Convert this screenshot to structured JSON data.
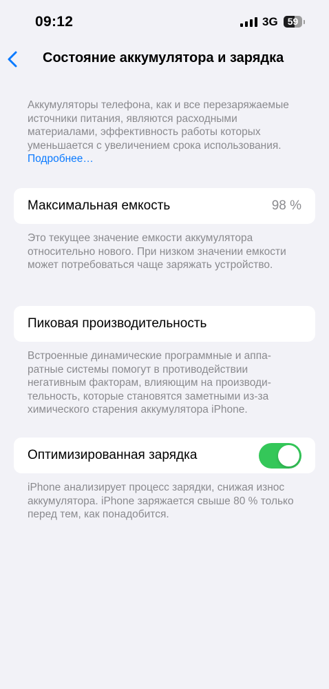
{
  "status_bar": {
    "time": "09:12",
    "network": "3G",
    "battery_level": "59",
    "battery_fraction": 0.59,
    "icons": [
      "signal-icon",
      "battery-icon"
    ]
  },
  "nav": {
    "back_icon": "chevron-left-icon",
    "title": "Состояние аккумулятора и зарядка"
  },
  "intro": {
    "text": "Аккумуляторы телефона, как и все перезаряжае­мые источники питания, являются расходными материалами, эффективность работы которых уменьшается с увеличением срока использования.",
    "learn_more": "Подробнее…"
  },
  "max_capacity": {
    "label": "Максимальная емкость",
    "value": "98 %",
    "footnote": "Это текущее значение емкости аккумулятора относительно нового. При низком значении емкости может потребоваться чаще заряжать устройство."
  },
  "peak_performance": {
    "label": "Пиковая производительность",
    "footnote": "Встроенные динамические программные и аппа­ратные системы помогут в противодействии негативным факторам, влияющим на производи­тельность, которые становятся заметными из-за химического старения аккумулятора iPhone."
  },
  "optimized_charging": {
    "label": "Оптимизированная зарядка",
    "enabled": true,
    "footnote": "iPhone анализирует процесс зарядки, снижая износ аккумулятора. iPhone заряжается свыше 80 % только перед тем, как понадобится."
  },
  "colors": {
    "background": "#f2f2f7",
    "accent": "#0a7aff",
    "toggle_on": "#34c759",
    "secondary_text": "#8a8a8e"
  }
}
